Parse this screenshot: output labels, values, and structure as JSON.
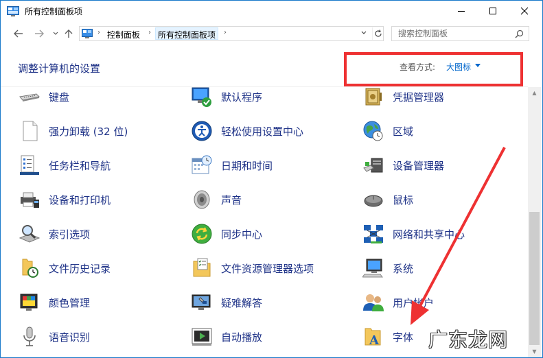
{
  "window": {
    "title": "所有控制面板项"
  },
  "address": {
    "segments": [
      "控制面板",
      "所有控制面板项"
    ]
  },
  "search": {
    "placeholder": "搜索控制面板"
  },
  "header": {
    "title": "调整计算机的设置",
    "view_label": "查看方式:",
    "view_value": "大图标"
  },
  "items": {
    "col1": [
      "键盘",
      "强力卸载 (32 位)",
      "任务栏和导航",
      "设备和打印机",
      "索引选项",
      "文件历史记录",
      "颜色管理",
      "语音识别"
    ],
    "col2": [
      "默认程序",
      "轻松使用设置中心",
      "日期和时间",
      "声音",
      "同步中心",
      "文件资源管理器选项",
      "疑难解答",
      "自动播放"
    ],
    "col3": [
      "凭据管理器",
      "区域",
      "设备管理器",
      "鼠标",
      "网络和共享中心",
      "系统",
      "用户帐户",
      "字体"
    ]
  },
  "watermark": "广东龙网",
  "colors": {
    "link": "#1e3287",
    "accent": "#0066cc",
    "annotation": "#ee3132"
  }
}
